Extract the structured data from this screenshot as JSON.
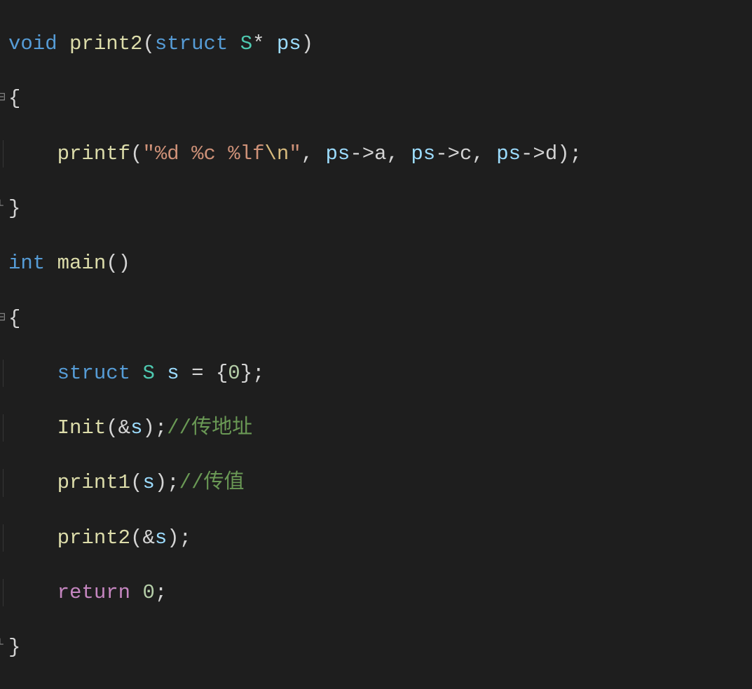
{
  "code": {
    "l1": {
      "void": "void",
      "sp1": " ",
      "fn": "print2",
      "paren_l": "(",
      "struct": "struct",
      "sp2": " ",
      "cls": "S",
      "star": "*",
      "sp3": " ",
      "param": "ps",
      "paren_r": ")"
    },
    "l2": {
      "brace": "{"
    },
    "l3": {
      "indent": "    ",
      "fn": "printf",
      "paren_l": "(",
      "q1": "\"",
      "fmt1": "%d %c %lf",
      "esc1": "\\n",
      "q2": "\"",
      "comma1": ", ",
      "v1": "ps",
      "arrow1": "->",
      "m1": "a",
      "comma2": ", ",
      "v2": "ps",
      "arrow2": "->",
      "m2": "c",
      "comma3": ", ",
      "v3": "ps",
      "arrow3": "->",
      "m3": "d",
      "paren_r": ")",
      "semi": ";"
    },
    "l4": {
      "brace": "}"
    },
    "l5": {
      "int": "int",
      "sp1": " ",
      "fn": "main",
      "parens": "()"
    },
    "l6": {
      "brace": "{"
    },
    "l7": {
      "indent": "    ",
      "struct": "struct",
      "sp1": " ",
      "cls": "S",
      "sp2": " ",
      "var": "s",
      "sp3": " ",
      "eq": "=",
      "sp4": " ",
      "brace_l": "{",
      "num": "0",
      "brace_r": "}",
      "semi": ";"
    },
    "l8": {
      "indent": "    ",
      "fn": "Init",
      "paren_l": "(",
      "amp": "&",
      "var": "s",
      "paren_r": ")",
      "semi": ";",
      "comment": "//传地址"
    },
    "l9": {
      "indent": "    ",
      "fn": "print1",
      "paren_l": "(",
      "var": "s",
      "paren_r": ")",
      "semi": ";",
      "comment": "//传值"
    },
    "l10": {
      "indent": "    ",
      "fn": "print2",
      "paren_l": "(",
      "amp": "&",
      "var": "s",
      "paren_r": ")",
      "semi": ";"
    },
    "l11": {
      "indent": "    ",
      "return": "return",
      "sp1": " ",
      "num": "0",
      "semi": ";"
    },
    "l12": {
      "brace": "}"
    }
  }
}
